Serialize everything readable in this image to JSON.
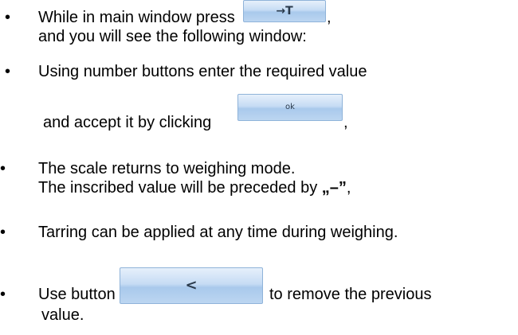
{
  "bullet_symbol": "•",
  "items": [
    {
      "line1_before": "While in main window press",
      "button_glyph": "→T",
      "line1_after": ",",
      "line2": "and you will see the following window:"
    },
    {
      "line1": "Using number buttons enter the required value",
      "line2_before": "and accept it by clicking",
      "button_glyph": "ok",
      "line2_after": ","
    },
    {
      "line1": "The scale returns to weighing mode.",
      "line2_before": "The inscribed value will be preceded by",
      "line2_quote": "„–”",
      "line2_after": ","
    },
    {
      "line1": "Tarring can be applied at any time during weighing."
    },
    {
      "line1_before": "Use button",
      "button_glyph": "<",
      "line1_after": "to remove the previous",
      "line2": "value."
    }
  ]
}
